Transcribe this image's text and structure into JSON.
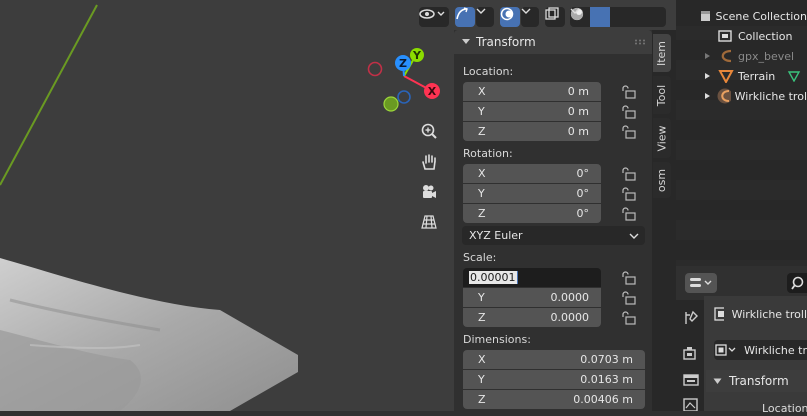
{
  "viewport": {
    "gizmo": {
      "x_label": "X",
      "y_label": "Y",
      "z_label": "Z"
    },
    "colors": {
      "x": "#ff3352",
      "y": "#8bdc00",
      "z": "#2890ff",
      "mesh": "#b9b9b9"
    }
  },
  "sidebar": {
    "panel_title": "Transform",
    "location": {
      "label": "Location:",
      "rows": [
        {
          "axis": "X",
          "value": "0 m"
        },
        {
          "axis": "Y",
          "value": "0 m"
        },
        {
          "axis": "Z",
          "value": "0 m"
        }
      ]
    },
    "rotation": {
      "label": "Rotation:",
      "rows": [
        {
          "axis": "X",
          "value": "0°"
        },
        {
          "axis": "Y",
          "value": "0°"
        },
        {
          "axis": "Z",
          "value": "0°"
        }
      ],
      "mode": "XYZ Euler"
    },
    "scale": {
      "label": "Scale:",
      "editing_value": "0.00001",
      "rows": [
        {
          "axis": "Y",
          "value": "0.0000"
        },
        {
          "axis": "Z",
          "value": "0.0000"
        }
      ]
    },
    "dimensions": {
      "label": "Dimensions:",
      "rows": [
        {
          "axis": "X",
          "value": "0.0703 m"
        },
        {
          "axis": "Y",
          "value": "0.0163 m"
        },
        {
          "axis": "Z",
          "value": "0.00406 m"
        }
      ]
    },
    "tabs": [
      "Item",
      "Tool",
      "View",
      "osm"
    ]
  },
  "outliner": {
    "items": [
      {
        "label": "Scene Collection"
      },
      {
        "label": "Collection"
      },
      {
        "label": "gpx_bevel"
      },
      {
        "label": "Terrain"
      },
      {
        "label": "Wirkliche trol"
      }
    ]
  },
  "properties": {
    "object_name": "Wirkliche troll",
    "data_name": "Wirkliche tr",
    "panel_title": "Transform",
    "sub_label": "Location"
  }
}
